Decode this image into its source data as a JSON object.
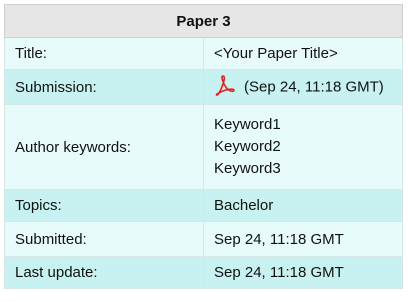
{
  "paper": {
    "heading": "Paper 3",
    "rows": {
      "title": {
        "label": "Title:",
        "value": "<Your Paper Title>"
      },
      "submission": {
        "label": "Submission:",
        "value": "(Sep 24, 11:18 GMT)",
        "icon": "pdf-icon"
      },
      "keywords": {
        "label": "Author keywords:",
        "values": [
          "Keyword1",
          "Keyword2",
          "Keyword3"
        ]
      },
      "topics": {
        "label": "Topics:",
        "value": "Bachelor"
      },
      "submitted": {
        "label": "Submitted:",
        "value": "Sep 24, 11:18 GMT"
      },
      "last_update": {
        "label": "Last update:",
        "value": "Sep 24, 11:18 GMT"
      }
    }
  },
  "colors": {
    "header_bg": "#e6e6e6",
    "row_light": "#e8fbfb",
    "row_dark": "#c8f1f1",
    "pdf_red": "#e0201b"
  }
}
